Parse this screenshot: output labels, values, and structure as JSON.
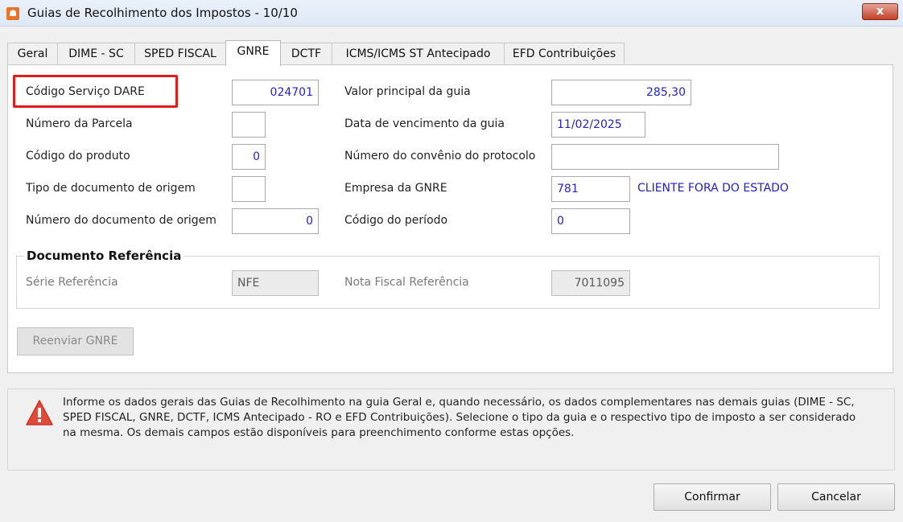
{
  "window": {
    "title": "Guias de Recolhimento dos Impostos - 10/10",
    "close_label": "x"
  },
  "tabs": [
    {
      "label": "Geral"
    },
    {
      "label": "DIME - SC"
    },
    {
      "label": "SPED FISCAL"
    },
    {
      "label": "GNRE"
    },
    {
      "label": "DCTF"
    },
    {
      "label": "ICMS/ICMS ST Antecipado"
    },
    {
      "label": "EFD Contribuições"
    }
  ],
  "active_tab": "GNRE",
  "form": {
    "codigo_servico_label": "Código Serviço DARE",
    "codigo_servico_value": "024701",
    "numero_parcela_label": "Número da Parcela",
    "numero_parcela_value": "",
    "codigo_produto_label": "Código do produto",
    "codigo_produto_value": "0",
    "tipo_doc_label": "Tipo de documento de origem",
    "tipo_doc_value": "",
    "numero_doc_label": "Número do documento de origem",
    "numero_doc_value": "0",
    "valor_principal_label": "Valor principal da guia",
    "valor_principal_value": "285,30",
    "data_vencimento_label": "Data de vencimento da guia",
    "data_vencimento_value": "11/02/2025",
    "convenio_label": "Número do convênio do protocolo",
    "convenio_value": "",
    "empresa_label": "Empresa da GNRE",
    "empresa_value": "781",
    "empresa_name": "CLIENTE FORA DO ESTADO",
    "codigo_periodo_label": "Código do período",
    "codigo_periodo_value": "0"
  },
  "documento_referencia": {
    "title": "Documento Referência",
    "serie_label": "Série Referência",
    "serie_value": "NFE",
    "nota_label": "Nota Fiscal Referência",
    "nota_value": "7011095"
  },
  "reenviar_label": "Reenviar GNRE",
  "info_message": "Informe os dados gerais das Guias de Recolhimento na guia Geral e, quando necessário, os dados complementares nas demais guias (DIME - SC, SPED FISCAL, GNRE, DCTF, ICMS Antecipado - RO e EFD Contribuições). Selecione o tipo da guia e o respectivo tipo de imposto a ser considerado na mesma. Os demais campos estão disponíveis para preenchimento conforme estas opções.",
  "buttons": {
    "confirm": "Confirmar",
    "cancel": "Cancelar"
  },
  "colors": {
    "highlight": "#e01c1c",
    "value_text": "#2323c8",
    "warning": "#e04a3a"
  },
  "icons": {
    "app": "app-logo-icon",
    "warning": "warning-icon",
    "close": "close-icon"
  }
}
